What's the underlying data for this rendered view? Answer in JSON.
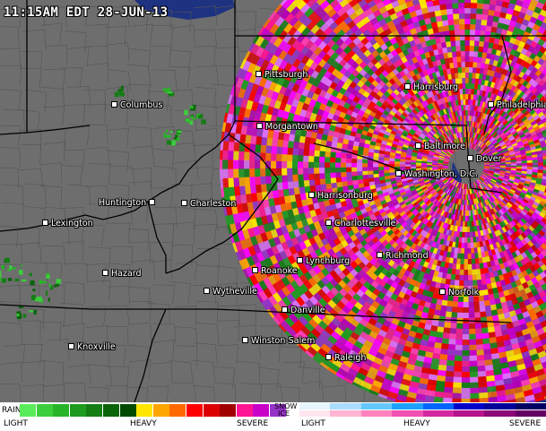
{
  "timestamp": "11:15AM EDT 28-JUN-13",
  "cities": [
    {
      "id": "pittsburgh",
      "name": "Pittsburgh"
    },
    {
      "id": "harrisburg",
      "name": "Harrisburg"
    },
    {
      "id": "philadelphia",
      "name": "Philadelphia"
    },
    {
      "id": "columbus",
      "name": "Columbus"
    },
    {
      "id": "morgantown",
      "name": "Morgantown"
    },
    {
      "id": "baltimore",
      "name": "Baltimore"
    },
    {
      "id": "dover",
      "name": "Dover"
    },
    {
      "id": "washington",
      "name": "Washington, D.C."
    },
    {
      "id": "harrisonburg",
      "name": "Harrisonburg"
    },
    {
      "id": "huntington",
      "name": "Huntington"
    },
    {
      "id": "charleston",
      "name": "Charleston"
    },
    {
      "id": "charlottesville",
      "name": "Charlottesville"
    },
    {
      "id": "lexington",
      "name": "Lexington"
    },
    {
      "id": "richmond",
      "name": "Richmond"
    },
    {
      "id": "lynchburg",
      "name": "Lynchburg"
    },
    {
      "id": "roanoke",
      "name": "Roanoke"
    },
    {
      "id": "hazard",
      "name": "Hazard"
    },
    {
      "id": "norfolk",
      "name": "Norfolk"
    },
    {
      "id": "wytheville",
      "name": "Wytheville"
    },
    {
      "id": "danville",
      "name": "Danville"
    },
    {
      "id": "winston-salem",
      "name": "Winston-Salem"
    },
    {
      "id": "knoxville",
      "name": "Knoxville"
    },
    {
      "id": "raleigh",
      "name": "Raleigh"
    }
  ],
  "legend": {
    "rain_label": "RAIN",
    "snow_label": "SNOW",
    "ice_label": "ICE",
    "rain_light": "LIGHT",
    "rain_heavy": "HEAVY",
    "rain_severe": "SEVERE",
    "snow_light": "LIGHT",
    "snow_heavy": "HEAVY",
    "snow_severe": "SEVERE",
    "rain_colors": [
      "#5aeb5a",
      "#3ccd3c",
      "#28b428",
      "#1e9b1e",
      "#147d14",
      "#0a640a",
      "#004b00",
      "#ffe600",
      "#ffa500",
      "#ff6a00",
      "#ff0000",
      "#dc0000",
      "#a00000",
      "#ff1493",
      "#c800c8",
      "#9632c8"
    ],
    "snow_colors": [
      "#e6f5ff",
      "#aadcff",
      "#64c8ff",
      "#1ea0ff",
      "#0064ff",
      "#0000c8",
      "#00009b",
      "#000064"
    ],
    "ice_colors": [
      "#ffe6f0",
      "#ffb4d2",
      "#ff82be",
      "#f050b4",
      "#d228a0",
      "#b4148c",
      "#8c0a78",
      "#640064"
    ]
  },
  "map_colors": {
    "land": "#6e6e6e",
    "water": "#1e3282",
    "county_lines": "#4a4a4a",
    "state_lines": "#000000"
  }
}
